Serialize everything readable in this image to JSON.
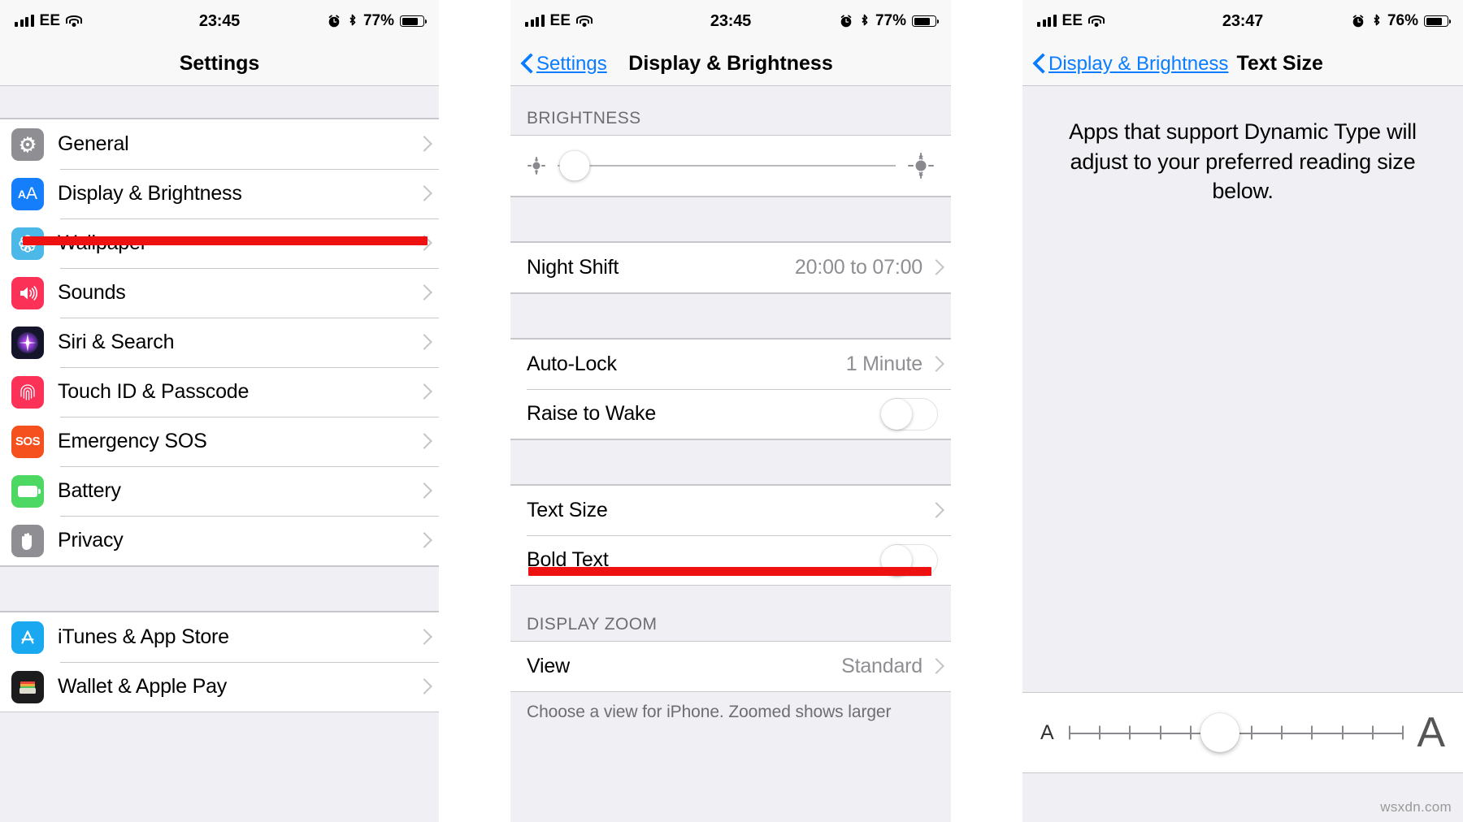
{
  "watermark": "wsxdn.com",
  "panels": {
    "settings": {
      "status": {
        "carrier": "EE",
        "time": "23:45",
        "battery_pct": "77%",
        "signal_icon": "signal-bars-icon",
        "wifi_icon": "wifi-icon",
        "alarm_icon": "alarm-clock-icon",
        "bluetooth_icon": "bluetooth-icon",
        "battery_icon": "battery-icon"
      },
      "nav": {
        "title": "Settings"
      },
      "groups": [
        {
          "rows": [
            {
              "label": "General",
              "icon": "gear-icon",
              "color": "#8e8e93"
            },
            {
              "label": "Display & Brightness",
              "icon": "text-size-aa-icon",
              "color": "#147efb",
              "highlighted": true
            },
            {
              "label": "Wallpaper",
              "icon": "flower-icon",
              "color": "#4cb8e8"
            },
            {
              "label": "Sounds",
              "icon": "speaker-icon",
              "color": "#fc3158"
            },
            {
              "label": "Siri & Search",
              "icon": "siri-orb-icon",
              "color": "#1c1c2e"
            },
            {
              "label": "Touch ID & Passcode",
              "icon": "fingerprint-icon",
              "color": "#fc3158"
            },
            {
              "label": "Emergency SOS",
              "icon": "sos-icon",
              "color": "#f4511e"
            },
            {
              "label": "Battery",
              "icon": "battery-green-icon",
              "color": "#4cd863"
            },
            {
              "label": "Privacy",
              "icon": "hand-icon",
              "color": "#8e8e93"
            }
          ]
        },
        {
          "rows": [
            {
              "label": "iTunes & App Store",
              "icon": "app-store-icon",
              "color": "#1aa9f0"
            },
            {
              "label": "Wallet & Apple Pay",
              "icon": "wallet-icon",
              "color": "#1c1c1e"
            }
          ]
        }
      ]
    },
    "display": {
      "status": {
        "carrier": "EE",
        "time": "23:45",
        "battery_pct": "77%"
      },
      "nav": {
        "back_label": "Settings",
        "title": "Display & Brightness"
      },
      "brightness_header": "BRIGHTNESS",
      "brightness_value_pct": 5,
      "brightness_icons": {
        "low": "sun-small-icon",
        "high": "sun-large-icon"
      },
      "rows": {
        "night_shift": {
          "label": "Night Shift",
          "value": "20:00 to 07:00"
        },
        "auto_lock": {
          "label": "Auto-Lock",
          "value": "1 Minute"
        },
        "raise_to_wake": {
          "label": "Raise to Wake",
          "toggle": "off"
        },
        "text_size": {
          "label": "Text Size",
          "highlighted": true
        },
        "bold_text": {
          "label": "Bold Text",
          "toggle": "off"
        }
      },
      "display_zoom_header": "DISPLAY ZOOM",
      "view_row": {
        "label": "View",
        "value": "Standard"
      },
      "view_footer": "Choose a view for iPhone. Zoomed shows larger"
    },
    "textsize": {
      "status": {
        "carrier": "EE",
        "time": "23:47",
        "battery_pct": "76%"
      },
      "nav": {
        "back_label": "Display & Brightness",
        "title": "Text Size"
      },
      "description": "Apps that support Dynamic Type will adjust to your preferred reading size below.",
      "slider": {
        "min_label": "A",
        "max_label": "A",
        "ticks": 12,
        "value_index": 5
      }
    }
  },
  "colors": {
    "accent_blue": "#0a7cff",
    "annotation_red": "#ee1111",
    "list_bg": "#efeff4",
    "separator": "#c8c7cc",
    "secondary_text": "#8e8e93"
  }
}
